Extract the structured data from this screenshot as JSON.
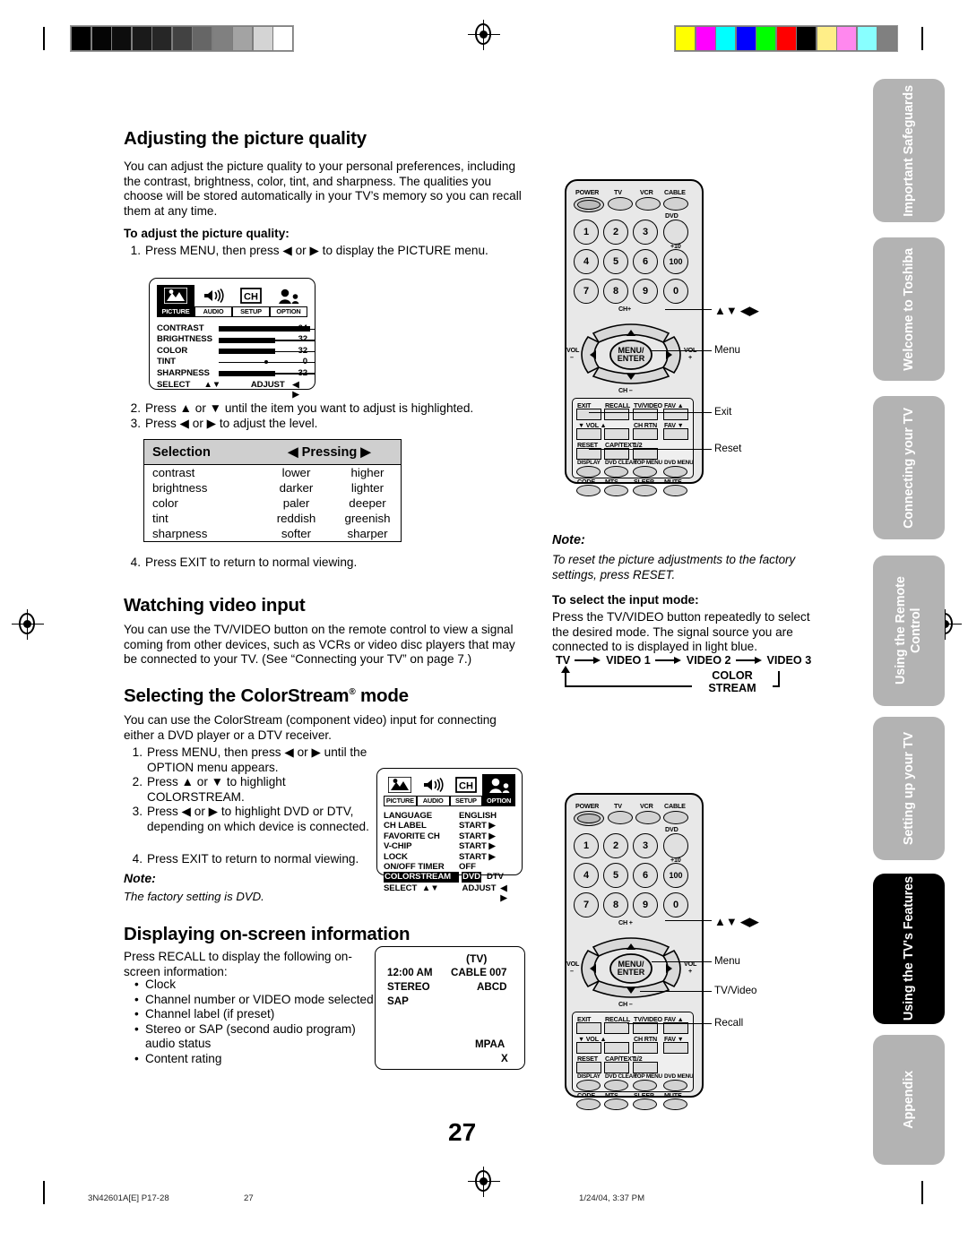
{
  "page": {
    "number": "27",
    "footer": {
      "doc_code": "3N42601A[E] P17-28",
      "page_num": "27",
      "timestamp": "1/24/04, 3:37 PM"
    }
  },
  "sidebar": {
    "tabs": [
      {
        "label": "Important Safeguards",
        "active": false
      },
      {
        "label": "Welcome to Toshiba",
        "active": false
      },
      {
        "label": "Connecting your TV",
        "active": false
      },
      {
        "label": "Using the Remote Control",
        "active": false
      },
      {
        "label": "Setting up your TV",
        "active": false
      },
      {
        "label": "Using the TV's Features",
        "active": true
      },
      {
        "label": "Appendix",
        "active": false
      }
    ]
  },
  "sections": {
    "picture_quality": {
      "heading": "Adjusting the picture quality",
      "intro": "You can adjust the picture quality to your personal preferences, including the contrast, brightness, color, tint, and sharpness. The qualities you choose will be stored automatically in your TV’s memory so you can recall them at any time.",
      "subheading": "To adjust the picture quality:",
      "steps": [
        {
          "num": "1.",
          "text": "Press MENU, then press ◀ or ▶ to display the PICTURE menu."
        },
        {
          "num": "2.",
          "text": "Press ▲ or ▼ until the item you want to adjust is highlighted."
        },
        {
          "num": "3.",
          "text": "Press ◀ or ▶ to adjust the level."
        },
        {
          "num": "4.",
          "text": "Press EXIT to return to normal viewing."
        }
      ],
      "table": {
        "headers": [
          "Selection",
          "◀  Pressing  ▶"
        ],
        "col1_header": "Selection",
        "col2_header": "Pressing",
        "left_arrow": "◀",
        "right_arrow": "▶",
        "rows": [
          {
            "selection": "contrast",
            "left": "lower",
            "right": "higher"
          },
          {
            "selection": "brightness",
            "left": "darker",
            "right": "lighter"
          },
          {
            "selection": "color",
            "left": "paler",
            "right": "deeper"
          },
          {
            "selection": "tint",
            "left": "reddish",
            "right": "greenish"
          },
          {
            "selection": "sharpness",
            "left": "softer",
            "right": "sharper"
          }
        ]
      }
    },
    "video_input": {
      "heading": "Watching video input",
      "body": "You can use the TV/VIDEO button on the remote control to view a signal coming from other devices, such as VCRs or video disc players that may be connected to your TV. (See “Connecting your TV” on page 7.)"
    },
    "colorstream": {
      "heading": "Selecting the ColorStream® mode",
      "heading_base": "Selecting the ColorStream",
      "heading_sup": "®",
      "heading_tail": " mode",
      "intro": "You can use the ColorStream (component video) input for connecting either a DVD player or a DTV receiver.",
      "steps": [
        {
          "num": "1.",
          "text": "Press MENU, then press ◀ or ▶ until the OPTION menu appears."
        },
        {
          "num": "2.",
          "text": "Press ▲ or ▼ to highlight COLORSTREAM."
        },
        {
          "num": "3.",
          "text": "Press ◀ or ▶ to highlight DVD or DTV, depending on which device is connected."
        },
        {
          "num": "4.",
          "text": "Press EXIT to return to normal viewing."
        }
      ],
      "note_label": "Note:",
      "note_text": "The factory setting is DVD."
    },
    "onscreen": {
      "heading": "Displaying on-screen information",
      "intro": "Press RECALL to display the following on-screen information:",
      "bullets": [
        "Clock",
        "Channel number or VIDEO mode selected",
        "Channel label (if preset)",
        "Stereo or SAP (second audio program) audio status",
        "Content rating"
      ]
    },
    "reset_note": {
      "label": "Note:",
      "text": "To reset the picture adjustments to the factory settings, press RESET."
    },
    "input_mode": {
      "subheading": "To select the input mode:",
      "body": "Press the TV/VIDEO button repeatedly to select the desired mode. The signal source you are connected to is displayed in light blue.",
      "flow": [
        "TV",
        "VIDEO 1",
        "VIDEO 2",
        "VIDEO 3"
      ],
      "loop_label_line1": "COLOR",
      "loop_label_line2": "STREAM"
    }
  },
  "osd_picture": {
    "tabs": [
      {
        "name": "PICTURE",
        "icon": "picture-icon",
        "selected": true
      },
      {
        "name": "AUDIO",
        "icon": "speaker-icon",
        "selected": false
      },
      {
        "name": "SETUP",
        "icon": "ch-icon",
        "selected": false
      },
      {
        "name": "OPTION",
        "icon": "person-icon",
        "selected": false
      }
    ],
    "rows": [
      {
        "label": "CONTRAST",
        "value": "64",
        "fill": 100,
        "type": "bar"
      },
      {
        "label": "BRIGHTNESS",
        "value": "32",
        "fill": 62,
        "type": "bar"
      },
      {
        "label": "COLOR",
        "value": "32",
        "fill": 62,
        "type": "bar"
      },
      {
        "label": "TINT",
        "value": "0",
        "fill": 50,
        "type": "dot"
      },
      {
        "label": "SHARPNESS",
        "value": "32",
        "fill": 62,
        "type": "bar"
      }
    ],
    "footer": {
      "select": "SELECT",
      "select_arrows": "▲▼",
      "adjust": "ADJUST",
      "adjust_arrows": "◀ ▶"
    }
  },
  "osd_option": {
    "tabs": [
      {
        "name": "PICTURE",
        "icon": "picture-icon",
        "selected": false
      },
      {
        "name": "AUDIO",
        "icon": "speaker-icon",
        "selected": false
      },
      {
        "name": "SETUP",
        "icon": "ch-icon",
        "selected": false
      },
      {
        "name": "OPTION",
        "icon": "person-icon",
        "selected": true
      }
    ],
    "rows": [
      {
        "label": "LANGUAGE",
        "value": "ENGLISH",
        "value2": "",
        "highlight": false
      },
      {
        "label": "CH LABEL",
        "value": "START ▶",
        "value2": "",
        "highlight": false
      },
      {
        "label": "FAVORITE CH",
        "value": "START ▶",
        "value2": "",
        "highlight": false
      },
      {
        "label": "V-CHIP",
        "value": "START ▶",
        "value2": "",
        "highlight": false
      },
      {
        "label": "LOCK",
        "value": "START ▶",
        "value2": "",
        "highlight": false
      },
      {
        "label": "ON/OFF TIMER",
        "value": "OFF",
        "value2": "",
        "highlight": false
      },
      {
        "label": "COLORSTREAM",
        "value": "DVD",
        "value2": "DTV",
        "highlight": true
      }
    ],
    "footer": {
      "select": "SELECT",
      "select_arrows": "▲▼",
      "adjust": "ADJUST",
      "adjust_arrows": "◀ ▶"
    }
  },
  "osd_recall": {
    "tv_label": "(TV)",
    "clock": "12:00 AM",
    "source": "CABLE  007",
    "channel_label": "ABCD",
    "audio1": "STEREO",
    "audio2": "SAP",
    "rating_label": "MPAA",
    "rating_value": "X"
  },
  "remote_top": {
    "labels": {
      "power": "POWER",
      "tv": "TV",
      "vcr": "VCR",
      "cable": "CABLE",
      "dvd": "DVD",
      "plus10": "+10",
      "hundred": "100",
      "ch_plus": "CH+",
      "ch_minus": "CH –",
      "vol_left": "VOL",
      "vol_left_sign": "–",
      "vol_right": "VOL",
      "vol_right_sign": "+",
      "menu_enter_1": "MENU/",
      "menu_enter_2": "ENTER"
    },
    "numbers": [
      "1",
      "2",
      "3",
      "4",
      "5",
      "6",
      "7",
      "8",
      "9",
      "0"
    ],
    "keys_row1": [
      "EXIT",
      "RECALL",
      "TV/VIDEO",
      "FAV ▲"
    ],
    "keys_row2": [
      "▼  VOL  ▲",
      "CH RTN",
      "FAV ▼"
    ],
    "keys_row3": [
      "RESET",
      "CAP/TEXT",
      "1/2"
    ],
    "keys_row4": [
      "DISPLAY",
      "DVD CLEAR",
      "TOP MENU",
      "DVD MENU"
    ],
    "keys_row5": [
      "CODE",
      "MTS",
      "SLEEP",
      "MUTE"
    ],
    "callouts": [
      "▲▼ ◀▶",
      "Menu",
      "Exit",
      "Reset"
    ]
  },
  "remote_bottom": {
    "labels": {
      "power": "POWER",
      "tv": "TV",
      "vcr": "VCR",
      "cable": "CABLE",
      "dvd": "DVD",
      "plus10": "+10",
      "hundred": "100",
      "ch_plus": "CH +",
      "ch_minus": "CH –",
      "vol_left": "VOL",
      "vol_left_sign": "–",
      "vol_right": "VOL",
      "vol_right_sign": "+",
      "menu_enter_1": "MENU/",
      "menu_enter_2": "ENTER"
    },
    "numbers": [
      "1",
      "2",
      "3",
      "4",
      "5",
      "6",
      "7",
      "8",
      "9",
      "0"
    ],
    "keys_row1": [
      "EXIT",
      "RECALL",
      "TV/VIDEO",
      "FAV ▲"
    ],
    "keys_row2": [
      "▼  VOL  ▲",
      "CH RTN",
      "FAV ▼"
    ],
    "keys_row3": [
      "RESET",
      "CAP/TEXT",
      "1/2"
    ],
    "keys_row4": [
      "DISPLAY",
      "DVD CLEAR",
      "TOP MENU",
      "DVD MENU"
    ],
    "keys_row5": [
      "CODE",
      "MTS",
      "SLEEP",
      "MUTE"
    ],
    "callouts": [
      "▲▼ ◀▶",
      "Menu",
      "TV/Video",
      "Recall"
    ]
  },
  "print_marks": {
    "grayscale_bars": [
      "#000000",
      "#050505",
      "#0d0d0d",
      "#1a1a1a",
      "#262626",
      "#424242",
      "#666666",
      "#808080",
      "#a3a3a3",
      "#d4d4d4",
      "#ffffff"
    ],
    "color_bars": [
      "#ffff00",
      "#ff00ff",
      "#00ffff",
      "#0000ff",
      "#00ff00",
      "#ff0000",
      "#000000",
      "#ffee88",
      "#ff88ee",
      "#88ffff",
      "#808080"
    ]
  }
}
